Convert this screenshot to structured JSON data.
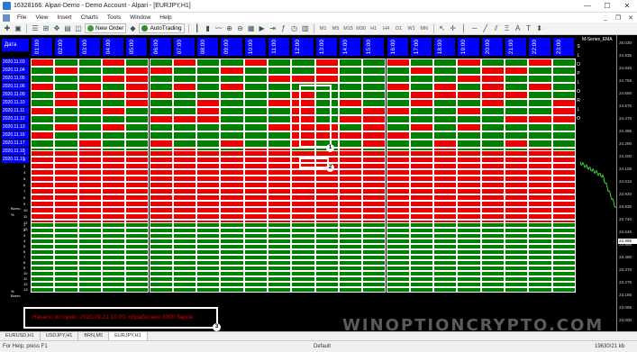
{
  "window": {
    "title": "16328166: Alpari-Demo - Demo Account - Alpari - [EURJPY,H1]",
    "controls": [
      "—",
      "☐",
      "✕"
    ]
  },
  "menu": {
    "items": [
      "File",
      "View",
      "Insert",
      "Charts",
      "Tools",
      "Window",
      "Help"
    ],
    "mdi": [
      "_",
      "❐",
      "✕"
    ]
  },
  "toolbar": {
    "new_order": "New Order",
    "autotrading": "AutoTrading",
    "timeframes": [
      "M1",
      "M5",
      "M15",
      "M30",
      "H1",
      "H4",
      "D1",
      "W1",
      "MN"
    ]
  },
  "chart": {
    "header_label": "Дата",
    "hours": [
      "01:00",
      "02:00",
      "03:00",
      "04:00",
      "05:00",
      "06:00",
      "07:00",
      "08:00",
      "09:00",
      "10:00",
      "11:00",
      "12:00",
      "13:00",
      "14:00",
      "15:00",
      "16:00",
      "17:00",
      "18:00",
      "19:00",
      "20:00",
      "21:00",
      "22:00",
      "23:00"
    ],
    "dates": [
      "2020.11.03",
      "2020.11.04",
      "2020.11.05",
      "2020.11.06",
      "2020.11.09",
      "2020.11.10",
      "2020.11.11",
      "2020.11.12",
      "2020.11.13",
      "2020.11.16",
      "2020.11.17",
      "2020.11.18",
      "2020.11.19"
    ],
    "side_letters": [
      "S",
      "L",
      "O",
      "P",
      "L",
      "O",
      "R",
      "L",
      "O"
    ],
    "mid_cell_value": "5",
    "mid_cell_value2": "6",
    "indicator_name": "M-Series_EMA",
    "row_label_total": "Всего",
    "row_label_pct": "%",
    "red_counts": [
      "1",
      "2",
      "3",
      "4",
      "5",
      "6",
      "7",
      "8",
      "9",
      "10",
      "11",
      "12",
      "13"
    ],
    "green_counts": [
      "1",
      "2",
      "3",
      "4",
      "5",
      "6",
      "7",
      "8",
      "9",
      "10",
      "11",
      "12",
      "13"
    ],
    "prices": [
      "25.030",
      "24.935",
      "24.845",
      "24.755",
      "24.660",
      "24.570",
      "24.475",
      "24.385",
      "24.290",
      "24.200",
      "24.105",
      "24.015",
      "23.920",
      "23.830",
      "23.740",
      "23.645",
      "23.555",
      "23.460",
      "23.370",
      "23.275",
      "23.185",
      "23.095",
      "23.000"
    ],
    "current_price": "23.995"
  },
  "annotations": [
    "1",
    "2",
    "3"
  ],
  "status_message": "Начало истории: 2020.09.21 10:00, обработано 3000 баров",
  "watermark": "WINOPTIONCRYPTO.COM",
  "tabs": [
    "EURUSD,H1",
    "USDJPY,H1",
    "BRN,M5",
    "EURJPY,H1"
  ],
  "active_tab": "EURJPY,H1",
  "statusbar": {
    "help": "For Help, press F1",
    "profile": "Default",
    "traffic": "19630/21 kb"
  }
}
